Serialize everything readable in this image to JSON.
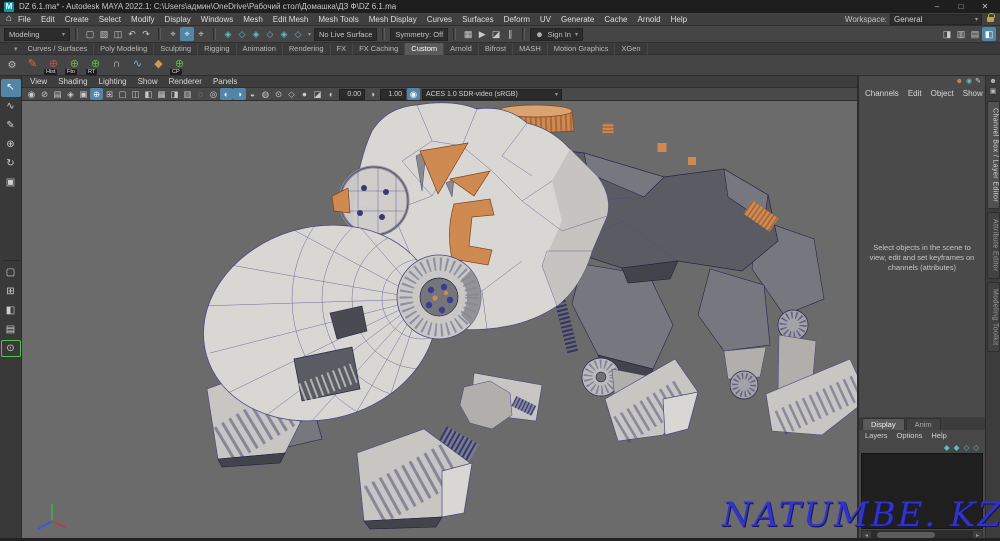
{
  "window": {
    "title": "DZ 6.1.ma* - Autodesk MAYA 2022.1: C:\\Users\\админ\\OneDrive\\Рабочий стол\\Домашка\\ДЗ Ф\\DZ 6.1.ma",
    "controls": [
      {
        "name": "minimize-button",
        "glyph": "–"
      },
      {
        "name": "maximize-button",
        "glyph": "□"
      },
      {
        "name": "close-button",
        "glyph": "✕"
      }
    ]
  },
  "menu_bar": {
    "items": [
      "File",
      "Edit",
      "Create",
      "Select",
      "Modify",
      "Display",
      "Windows",
      "Mesh",
      "Edit Mesh",
      "Mesh Tools",
      "Mesh Display",
      "Curves",
      "Surfaces",
      "Deform",
      "UV",
      "Generate",
      "Cache",
      "Arnold",
      "Help"
    ],
    "workspace_label": "Workspace:",
    "workspace_value": "General"
  },
  "status_line": {
    "mode": "Modeling",
    "file_icons": [
      {
        "name": "new-scene-icon",
        "glyph": "▢"
      },
      {
        "name": "open-scene-icon",
        "glyph": "▧"
      },
      {
        "name": "save-scene-icon",
        "glyph": "◫"
      },
      {
        "name": "undo-icon",
        "glyph": "↶"
      },
      {
        "name": "redo-icon",
        "glyph": "↷"
      }
    ],
    "select_icons": [
      {
        "name": "select-hierarchy-icon",
        "glyph": "⌖"
      },
      {
        "name": "select-object-icon",
        "glyph": "⌖",
        "active": true
      },
      {
        "name": "select-component-icon",
        "glyph": "⌖"
      }
    ],
    "snap_icons": [
      {
        "name": "snap-grid-icon",
        "glyph": "◈"
      },
      {
        "name": "snap-curve-icon",
        "glyph": "◇"
      },
      {
        "name": "snap-point-icon",
        "glyph": "◈"
      },
      {
        "name": "snap-projected-center-icon",
        "glyph": "◇"
      },
      {
        "name": "snap-view-plane-icon",
        "glyph": "◈"
      },
      {
        "name": "make-live-icon",
        "glyph": "◇"
      }
    ],
    "live_surface": "No Live Surface",
    "symmetry": "Symmetry: Off",
    "render_icons": [
      {
        "name": "render-frame-icon",
        "glyph": "▦"
      },
      {
        "name": "ipr-render-icon",
        "glyph": "▶"
      },
      {
        "name": "render-settings-icon",
        "glyph": "◪"
      },
      {
        "name": "pause-viewport-icon",
        "glyph": "∥"
      }
    ],
    "sign_in": "Sign In",
    "panel_toggles": [
      {
        "name": "toggle-modeling-toolkit-icon",
        "glyph": "◨"
      },
      {
        "name": "toggle-attribute-editor-icon",
        "glyph": "▥"
      },
      {
        "name": "toggle-tool-settings-icon",
        "glyph": "▤"
      },
      {
        "name": "toggle-channel-box-icon",
        "glyph": "◧",
        "active": true
      }
    ]
  },
  "shelf": {
    "tabs": [
      {
        "label": "Curves / Surfaces"
      },
      {
        "label": "Poly Modeling"
      },
      {
        "label": "Sculpting"
      },
      {
        "label": "Rigging"
      },
      {
        "label": "Animation"
      },
      {
        "label": "Rendering"
      },
      {
        "label": "FX"
      },
      {
        "label": "FX Caching"
      },
      {
        "label": "Custom",
        "active": true
      },
      {
        "label": "Arnold"
      },
      {
        "label": "Bifrost"
      },
      {
        "label": "MASH"
      },
      {
        "label": "Motion Graphics"
      },
      {
        "label": "XGen"
      }
    ],
    "buttons": [
      {
        "name": "shelf-item-notes",
        "glyph": "✎",
        "label": "",
        "color": "#e06a4a"
      },
      {
        "name": "shelf-item-hist",
        "glyph": "⊕",
        "label": "Hist",
        "color": "#c05050"
      },
      {
        "name": "shelf-item-fto",
        "glyph": "⊕",
        "label": "Fto",
        "color": "#6cb04e"
      },
      {
        "name": "shelf-item-rt",
        "glyph": "⊕",
        "label": "RT",
        "color": "#6cb04e"
      },
      {
        "name": "shelf-item-arc-curve",
        "glyph": "∩",
        "label": "",
        "color": "#cfcfcf"
      },
      {
        "name": "shelf-item-cv-curve",
        "glyph": "∿",
        "label": "",
        "color": "#7aaccc"
      },
      {
        "name": "shelf-item-plane",
        "glyph": "◆",
        "label": "",
        "color": "#c9995c"
      },
      {
        "name": "shelf-item-cp",
        "glyph": "⊕",
        "label": "CP",
        "color": "#6cb04e"
      }
    ]
  },
  "toolbox": {
    "tools": [
      {
        "name": "select-tool",
        "glyph": "↖",
        "active": true
      },
      {
        "name": "lasso-tool",
        "glyph": "∿"
      },
      {
        "name": "paint-select-tool",
        "glyph": "✎"
      },
      {
        "name": "move-tool",
        "glyph": "⊕"
      },
      {
        "name": "rotate-tool",
        "glyph": "↻"
      },
      {
        "name": "scale-tool",
        "glyph": "▣"
      }
    ],
    "layouts": [
      {
        "name": "layout-single-pane",
        "glyph": "▢"
      },
      {
        "name": "layout-four-pane",
        "glyph": "⊞"
      },
      {
        "name": "layout-two-pane",
        "glyph": "◧"
      },
      {
        "name": "layout-persp-outliner",
        "glyph": "▤"
      }
    ]
  },
  "panel_menu": {
    "items": [
      "View",
      "Shading",
      "Lighting",
      "Show",
      "Renderer",
      "Panels"
    ]
  },
  "viewport_bar": {
    "icons": [
      {
        "name": "select-camera-icon",
        "glyph": "◉"
      },
      {
        "name": "lock-camera-icon",
        "glyph": "⊘"
      },
      {
        "name": "camera-attributes-icon",
        "glyph": "▤"
      },
      {
        "name": "bookmarks-icon",
        "glyph": "◈"
      },
      {
        "name": "image-plane-icon",
        "glyph": "▣"
      },
      {
        "name": "pan-zoom-icon",
        "glyph": "⊕",
        "active": true
      },
      {
        "name": "grid-icon",
        "glyph": "⊞"
      },
      {
        "name": "film-gate-icon",
        "glyph": "▢"
      },
      {
        "name": "resolution-gate-icon",
        "glyph": "◫"
      },
      {
        "name": "gate-mask-icon",
        "glyph": "◧"
      },
      {
        "name": "field-chart-icon",
        "glyph": "▦"
      },
      {
        "name": "safe-action-icon",
        "glyph": "◨"
      },
      {
        "name": "safe-title-icon",
        "glyph": "▥"
      },
      {
        "name": "frame-all-icon",
        "glyph": "◌"
      },
      {
        "name": "frame-selection-icon",
        "glyph": "◎"
      },
      {
        "name": "lighting-icon",
        "glyph": "◐",
        "active": true
      },
      {
        "name": "shadows-icon",
        "glyph": "◑",
        "active": true
      },
      {
        "name": "occlusion-icon",
        "glyph": "◒"
      },
      {
        "name": "motion-blur-icon",
        "glyph": "◍"
      },
      {
        "name": "isolate-select-icon",
        "glyph": "⊙"
      },
      {
        "name": "wireframe-mode-icon",
        "glyph": "◇"
      },
      {
        "name": "shaded-mode-icon",
        "glyph": "●"
      },
      {
        "name": "textured-mode-icon",
        "glyph": "◪"
      }
    ],
    "exposure_icon": {
      "name": "exposure-icon",
      "glyph": "◐"
    },
    "exposure": "0.00",
    "gamma_icon": {
      "name": "gamma-icon",
      "glyph": "◑"
    },
    "gamma": "1.00",
    "colorspace_icon": {
      "name": "color-management-icon",
      "glyph": "◉",
      "active": true
    },
    "colorspace": "ACES 1.0 SDR-video (sRGB)"
  },
  "channel_box": {
    "top_icons": [
      {
        "name": "channel-manipulator-icon",
        "glyph": "☻",
        "color": "#cf8a52"
      },
      {
        "name": "channel-speed-icon",
        "glyph": "◉",
        "color": "#5fc0c0"
      },
      {
        "name": "channel-edit-icon",
        "glyph": "✎",
        "color": "#cfcfcf"
      }
    ],
    "menus": [
      "Channels",
      "Edit",
      "Object",
      "Show"
    ],
    "message": "Select objects in the scene to view, edit and set keyframes on channels (attributes)"
  },
  "layer_panel": {
    "tabs": [
      {
        "label": "Display",
        "active": true
      },
      {
        "label": "Anim"
      }
    ],
    "menus": [
      "Layers",
      "Options",
      "Help"
    ],
    "icons": [
      {
        "name": "layer-empty-icon",
        "glyph": "◆"
      },
      {
        "name": "layer-from-selected-icon",
        "glyph": "◆"
      },
      {
        "name": "layer-move-up-icon",
        "glyph": "◇"
      },
      {
        "name": "layer-move-down-icon",
        "glyph": "◇"
      }
    ]
  },
  "side_tabs": [
    {
      "label": "Channel Box / Layer Editor",
      "active": true
    },
    {
      "label": "Attribute Editor"
    },
    {
      "label": "Modeling Toolkit"
    }
  ],
  "watermark": "NATUMBE. KZ",
  "colors": {
    "viewport_bg": "#6b6b6b",
    "accent_blue": "#5285a6",
    "model_orange": "#cf8a52",
    "wireframe_navy": "#46467e",
    "watermark_blue": "#3232cc"
  }
}
